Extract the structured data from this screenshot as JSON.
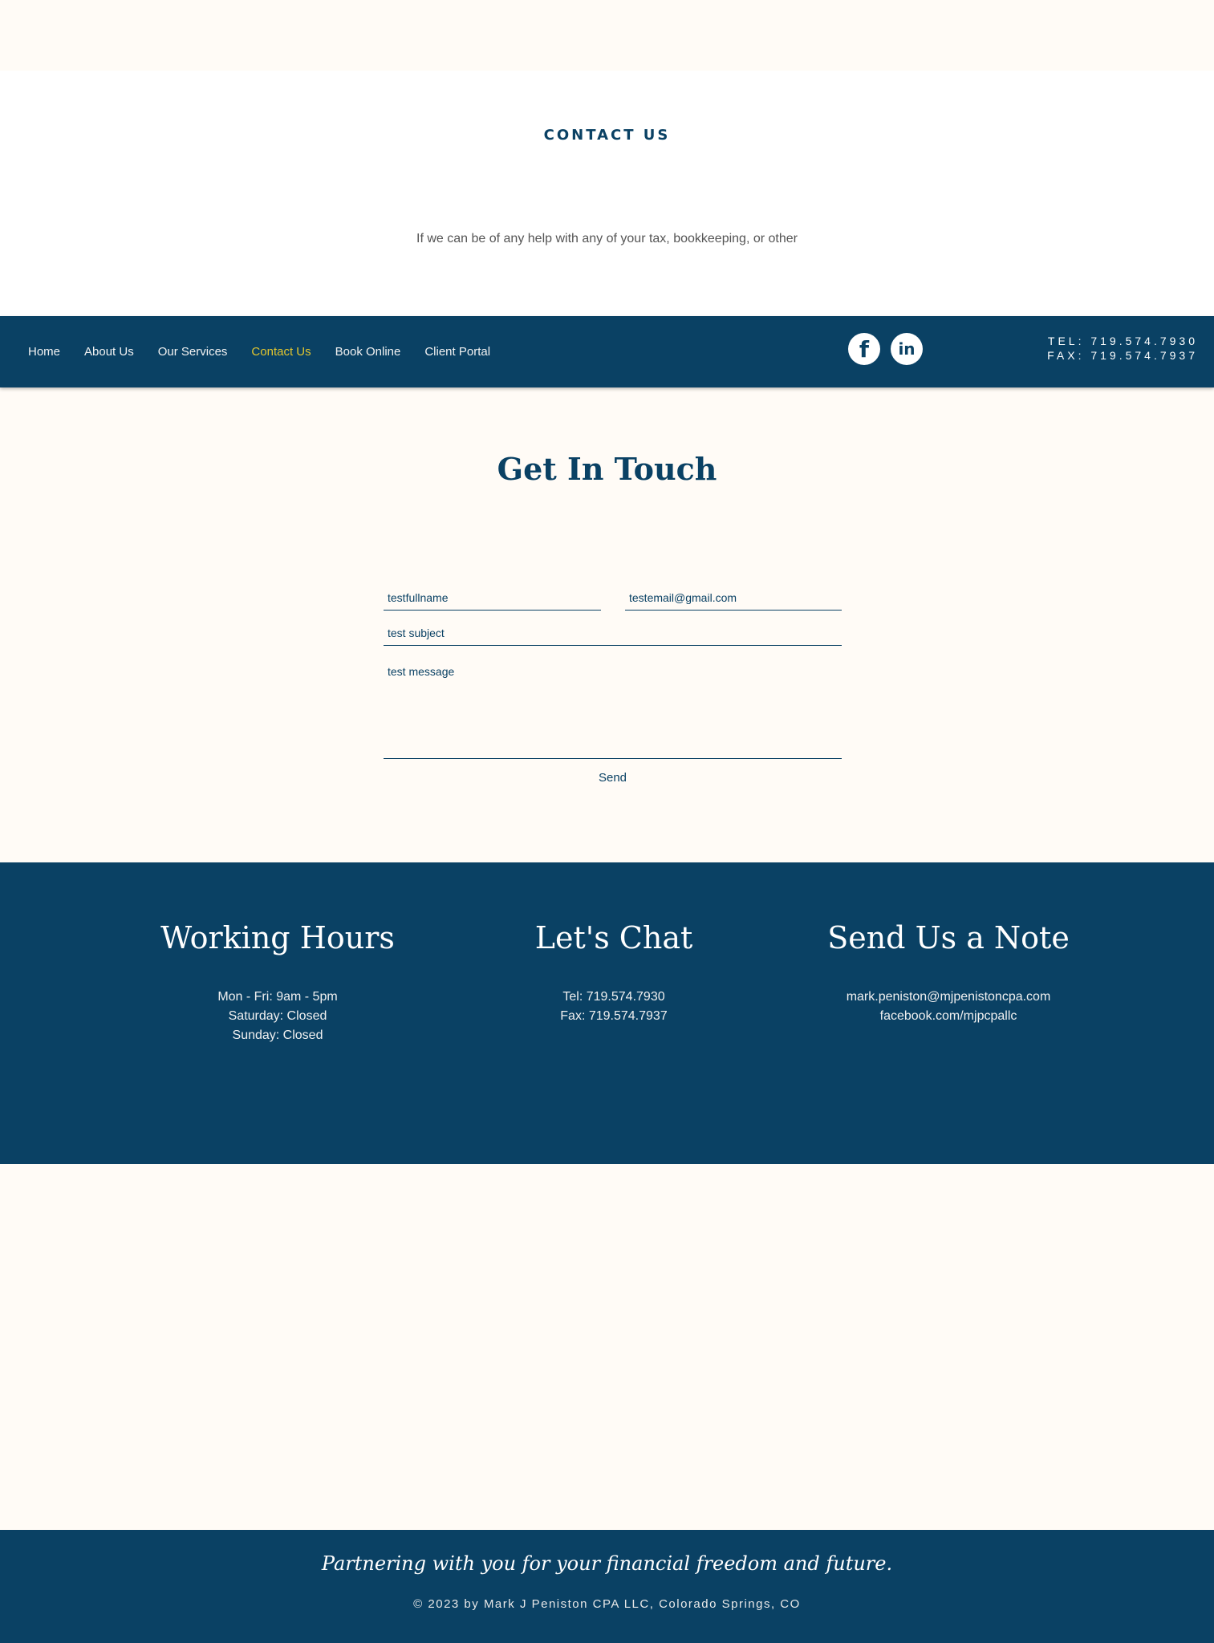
{
  "hero": {
    "title": "CONTACT US",
    "intro": "If we can be of any help with any of your tax, bookkeeping, or other"
  },
  "nav": {
    "items": [
      {
        "label": "Home",
        "active": false
      },
      {
        "label": "About Us",
        "active": false
      },
      {
        "label": "Our Services",
        "active": false
      },
      {
        "label": "Contact Us",
        "active": true
      },
      {
        "label": "Book Online",
        "active": false
      },
      {
        "label": "Client Portal",
        "active": false
      }
    ],
    "social": {
      "facebook": "f",
      "linkedin": "in"
    },
    "tel": "TEL: 719.574.7930",
    "fax": "FAX: 719.574.7937"
  },
  "form": {
    "title": "Get In Touch",
    "name_value": "testfullname",
    "email_value": "testemail@gmail.com",
    "subject_value": "test subject",
    "message_value": "test message",
    "send_label": "Send"
  },
  "info": {
    "hours": {
      "title": "Working Hours",
      "lines": [
        "Mon - Fri: 9am - 5pm",
        "Saturday: Closed",
        "Sunday: Closed"
      ]
    },
    "chat": {
      "title": "Let's Chat",
      "lines": [
        "Tel: 719.574.7930",
        "Fax: 719.574.7937"
      ]
    },
    "note": {
      "title": "Send Us a Note",
      "lines": [
        "mark.peniston@mjpenistoncpa.com",
        "facebook.com/mjpcpallc"
      ]
    }
  },
  "footer": {
    "tagline": "Partnering with you for your financial freedom and future.",
    "copyright": "© 2023 by Mark J Peniston CPA LLC, Colorado Springs, CO"
  },
  "colors": {
    "navy": "#0a4164",
    "cream": "#fffbf6",
    "active_nav": "#e3c62e"
  }
}
